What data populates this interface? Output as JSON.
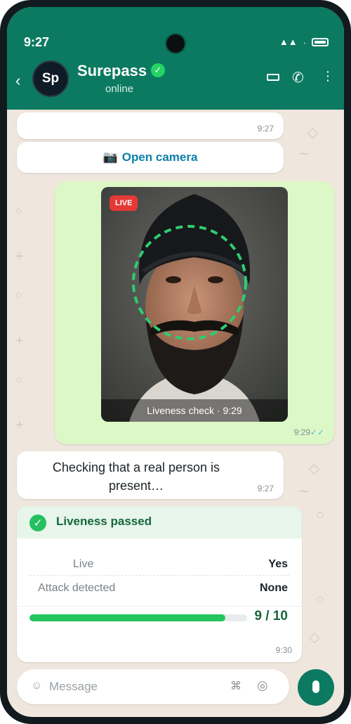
{
  "status_bar": {
    "time": "9:27"
  },
  "header": {
    "back_label": "‹",
    "avatar_initials": "Sp",
    "contact_name": "Surepass",
    "verified_mark": "✓",
    "contact_status": "online"
  },
  "messages": {
    "first_bubble_time": "9:27",
    "open_camera": {
      "icon": "📷",
      "label": "Open camera"
    },
    "photo": {
      "live_badge": "LIVE",
      "caption": "Liveness check · 9:29",
      "time": "9:29",
      "ticks": "✓✓"
    },
    "checking": {
      "text": "Checking that a real person is present…",
      "time": "9:27"
    },
    "result": {
      "title": "Liveness passed",
      "rows": [
        {
          "label": "Live",
          "value": "Yes"
        },
        {
          "label": "Attack detected",
          "value": "None"
        }
      ],
      "progress_fraction": 0.9,
      "score": "9 / 10",
      "time": "9:30"
    }
  },
  "composer": {
    "placeholder": "Message"
  },
  "colors": {
    "header": "#0b7a61",
    "chat_bg": "#efe7dd",
    "sent_bubble": "#dcf8c6",
    "accent_green": "#22c55e"
  }
}
